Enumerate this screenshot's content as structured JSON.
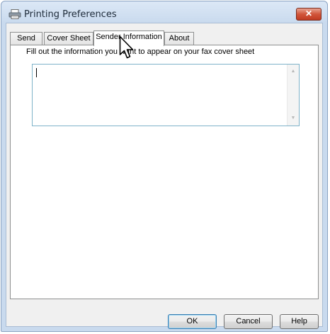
{
  "window": {
    "title": "Printing Preferences",
    "close_symbol": "✕"
  },
  "tabs": [
    {
      "label": "Send",
      "active": false
    },
    {
      "label": "Cover Sheet",
      "active": false
    },
    {
      "label": "Sender Information",
      "active": true
    },
    {
      "label": "About",
      "active": false
    }
  ],
  "sender_information": {
    "instruction": "Fill out the information you want to appear on your fax cover sheet",
    "text_value": ""
  },
  "buttons": {
    "ok": "OK",
    "cancel": "Cancel",
    "help": "Help"
  },
  "icons": {
    "app": "printer-icon",
    "cursor": "mouse-pointer-icon",
    "scroll_up": "scroll-up-arrow-icon",
    "scroll_down": "scroll-down-arrow-icon"
  },
  "colors": {
    "close_button": "#c94a30",
    "default_button_border": "#3c7fb1"
  }
}
